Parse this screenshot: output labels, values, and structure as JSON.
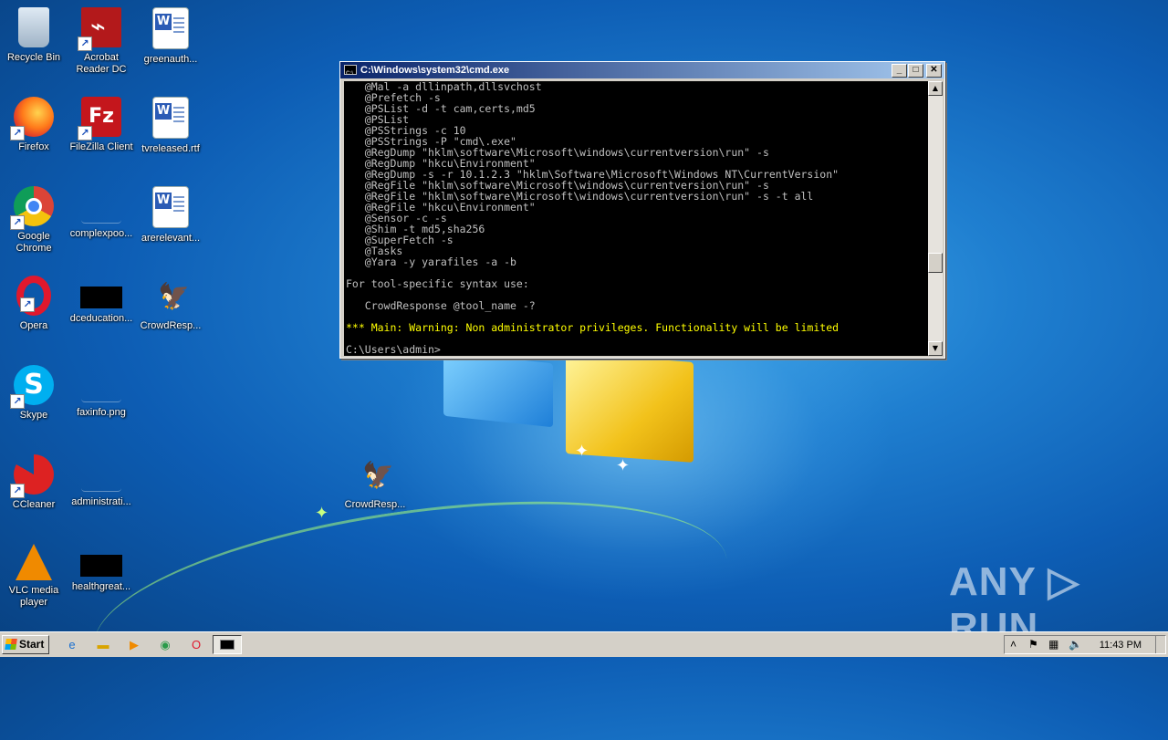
{
  "desktop": {
    "icons": [
      {
        "label": "Recycle Bin"
      },
      {
        "label": "Acrobat\nReader DC"
      },
      {
        "label": "greenauth..."
      },
      {
        "label": "Firefox"
      },
      {
        "label": "FileZilla Client"
      },
      {
        "label": "tvreleased.rtf"
      },
      {
        "label": "Google\nChrome"
      },
      {
        "label": "complexpoo..."
      },
      {
        "label": "arerelevant..."
      },
      {
        "label": "Opera"
      },
      {
        "label": "dceducation..."
      },
      {
        "label": "CrowdResp..."
      },
      {
        "label": "Skype"
      },
      {
        "label": "faxinfo.png"
      },
      {
        "label": "CCleaner"
      },
      {
        "label": "administrati..."
      },
      {
        "label": "CrowdResp..."
      },
      {
        "label": "VLC media\nplayer"
      },
      {
        "label": "healthgreat..."
      }
    ]
  },
  "cmd_window": {
    "title": "C:\\Windows\\system32\\cmd.exe",
    "minimize": "_",
    "maximize": "□",
    "close": "✕",
    "lines": [
      "   @Mal -a dllinpath,dllsvchost",
      "   @Prefetch -s",
      "   @PSList -d -t cam,certs,md5",
      "   @PSList",
      "   @PSStrings -c 10",
      "   @PSStrings -P \"cmd\\.exe\"",
      "   @RegDump \"hklm\\software\\Microsoft\\windows\\currentversion\\run\" -s",
      "   @RegDump \"hkcu\\Environment\"",
      "   @RegDump -s -r 10.1.2.3 \"hklm\\Software\\Microsoft\\Windows NT\\CurrentVersion\"",
      "   @RegFile \"hklm\\software\\Microsoft\\windows\\currentversion\\run\" -s",
      "   @RegFile \"hklm\\software\\Microsoft\\windows\\currentversion\\run\" -s -t all",
      "   @RegFile \"hkcu\\Environment\"",
      "   @Sensor -c -s",
      "   @Shim -t md5,sha256",
      "   @SuperFetch -s",
      "   @Tasks",
      "   @Yara -y yarafiles -a -b",
      "",
      "For tool-specific syntax use:",
      "",
      "   CrowdResponse @tool_name -?",
      ""
    ],
    "warning": "*** Main: Warning: Non administrator privileges. Functionality will be limited",
    "blank_after": "",
    "prompt": "C:\\Users\\admin>",
    "scrollbar": {
      "up": "▲",
      "down": "▼"
    }
  },
  "watermark": "ANY ▷ RUN",
  "taskbar": {
    "start_label": "Start",
    "quicklaunch": [
      "ie-icon",
      "explorer-icon",
      "media-player-icon",
      "chrome-icon",
      "opera-icon"
    ],
    "tray": {
      "chevron": "˄",
      "clock": "11:43 PM"
    }
  }
}
